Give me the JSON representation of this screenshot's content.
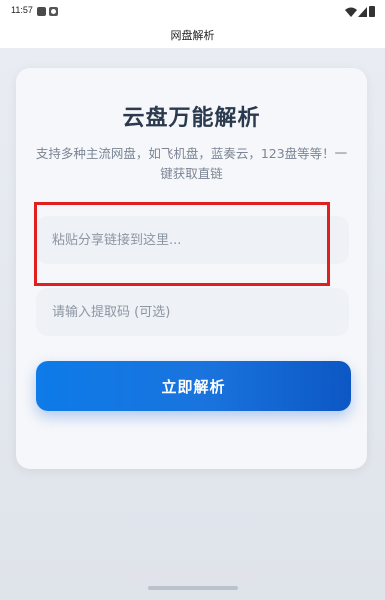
{
  "status_bar": {
    "time": "11:57",
    "icons": [
      "app-notification-icon",
      "app-notification-icon",
      "wifi-icon",
      "signal-icon",
      "battery-icon"
    ]
  },
  "app_bar": {
    "title": "网盘解析"
  },
  "card": {
    "title": "云盘万能解析",
    "subtitle": "支持多种主流网盘，如飞机盘，蓝奏云，123盘等等！一键获取直链",
    "link_input": {
      "placeholder": "粘贴分享链接到这里...",
      "value": ""
    },
    "code_input": {
      "placeholder": "请输入提取码 (可选)",
      "value": ""
    },
    "submit_label": "立即解析"
  },
  "colors": {
    "accent": "#1a73dd",
    "highlight": "#e0201e",
    "title": "#2b3a4e",
    "subtitle": "#7b8594"
  }
}
